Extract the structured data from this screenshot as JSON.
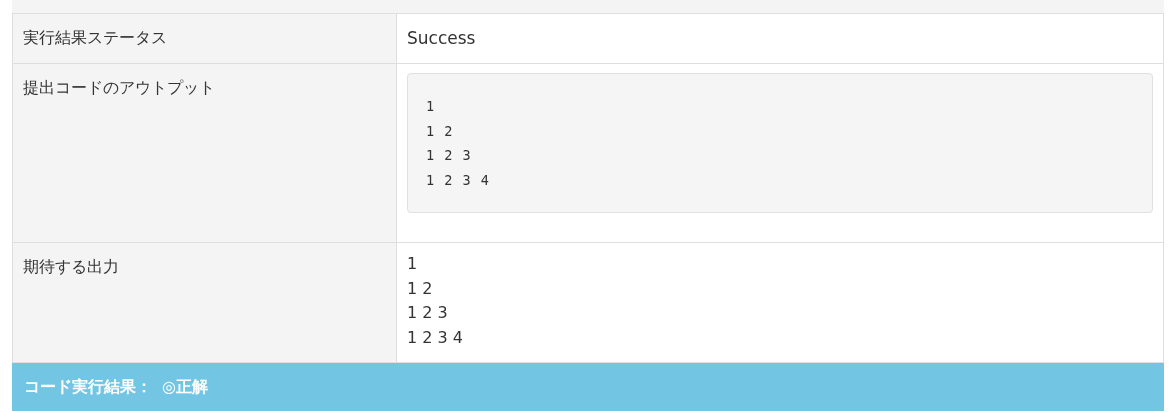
{
  "result_table": {
    "rows": [
      {
        "label": "実行結果ステータス",
        "kind": "text",
        "value": "Success"
      },
      {
        "label": "提出コードのアウトプット",
        "kind": "code",
        "value": "1\n1 2\n1 2 3\n1 2 3 4"
      },
      {
        "label": "期待する出力",
        "kind": "multiline",
        "value": "1\n1 2\n1 2 3\n1 2 3 4"
      }
    ]
  },
  "result_banner": {
    "label": "コード実行結果：",
    "verdict": "◎正解"
  }
}
